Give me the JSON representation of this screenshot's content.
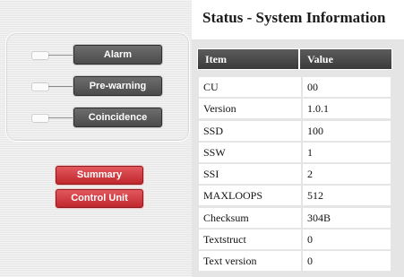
{
  "indicators": [
    {
      "label": "Alarm"
    },
    {
      "label": "Pre-warning"
    },
    {
      "label": "Coincidence"
    }
  ],
  "nav": {
    "summary_label": "Summary",
    "control_unit_label": "Control Unit"
  },
  "page": {
    "title": "Status - System Information"
  },
  "table": {
    "headers": {
      "item": "Item",
      "value": "Value"
    },
    "rows": [
      {
        "item": "CU",
        "value": "00"
      },
      {
        "item": "Version",
        "value": "1.0.1"
      },
      {
        "item": "SSD",
        "value": "100"
      },
      {
        "item": "SSW",
        "value": "1"
      },
      {
        "item": "SSI",
        "value": "2"
      },
      {
        "item": "MAXLOOPS",
        "value": "512"
      },
      {
        "item": "Checksum",
        "value": "304B"
      },
      {
        "item": "Textstruct",
        "value": "0"
      },
      {
        "item": "Text version",
        "value": "0"
      }
    ]
  },
  "colors": {
    "indicator_button": "#555555",
    "nav_button": "#d23a40",
    "table_header": "#4a4a4a",
    "table_background": "#e5e5e5"
  }
}
